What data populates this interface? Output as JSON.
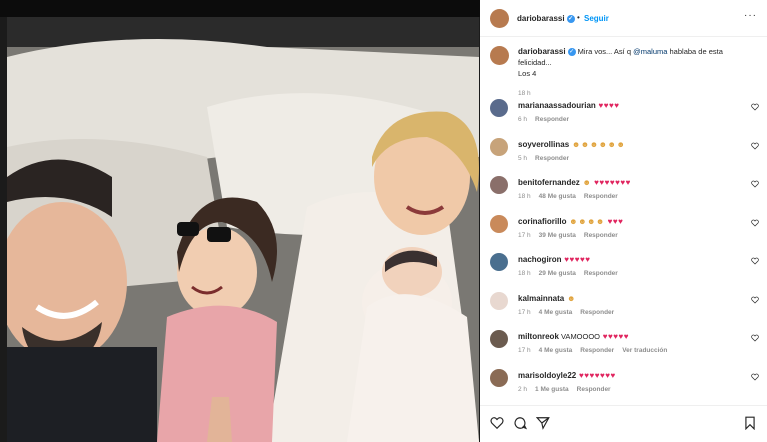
{
  "post": {
    "header_user": "dariobarassi",
    "follow_label": "Seguir",
    "more_label": "···"
  },
  "caption": {
    "user": "dariobarassi",
    "text_before": "Mira vos... Así q",
    "mention": "@maluma",
    "text_after": "hablaba de esta felicidad...",
    "line2": "Los 4",
    "time": "18 h"
  },
  "comments": [
    {
      "user": "marianaassadourian",
      "text": "",
      "hearts": 4,
      "faces": 0,
      "time": "6 h",
      "likes": "",
      "reply": "Responder",
      "translate": "",
      "avatar_color": "#5a6b8c"
    },
    {
      "user": "soyverollinas",
      "text": "",
      "hearts": 0,
      "faces": 6,
      "time": "5 h",
      "likes": "",
      "reply": "Responder",
      "translate": "",
      "avatar_color": "#c7a37a"
    },
    {
      "user": "benitofernandez",
      "text": "",
      "hearts": 7,
      "faces": 1,
      "time": "18 h",
      "likes": "48 Me gusta",
      "reply": "Responder",
      "translate": "",
      "avatar_color": "#8a6f6a"
    },
    {
      "user": "corinafiorillo",
      "text": "",
      "hearts": 3,
      "faces": 4,
      "time": "17 h",
      "likes": "39 Me gusta",
      "reply": "Responder",
      "translate": "",
      "avatar_color": "#c98a5b"
    },
    {
      "user": "nachogiron",
      "text": "",
      "hearts": 5,
      "faces": 0,
      "time": "18 h",
      "likes": "29 Me gusta",
      "reply": "Responder",
      "translate": "",
      "avatar_color": "#4a6f8f"
    },
    {
      "user": "kalmainnata",
      "text": "",
      "hearts": 0,
      "faces": 1,
      "time": "17 h",
      "likes": "4 Me gusta",
      "reply": "Responder",
      "translate": "",
      "avatar_color": "#e8d8d0"
    },
    {
      "user": "miltonreok",
      "text": "VAMOOOO",
      "hearts": 5,
      "faces": 0,
      "time": "17 h",
      "likes": "4 Me gusta",
      "reply": "Responder",
      "translate": "Ver traducción",
      "avatar_color": "#6b5b4f"
    },
    {
      "user": "marisoldoyle22",
      "text": "",
      "hearts": 7,
      "faces": 0,
      "time": "2 h",
      "likes": "1 Me gusta",
      "reply": "Responder",
      "translate": "",
      "avatar_color": "#8a6b55"
    }
  ],
  "colors": {
    "accent": "#0095f6",
    "heart": "#e0245e",
    "verified": "#3897f0"
  },
  "icons": [
    "heart-icon",
    "comment-icon",
    "share-icon",
    "bookmark-icon",
    "verified-icon",
    "more-icon"
  ]
}
